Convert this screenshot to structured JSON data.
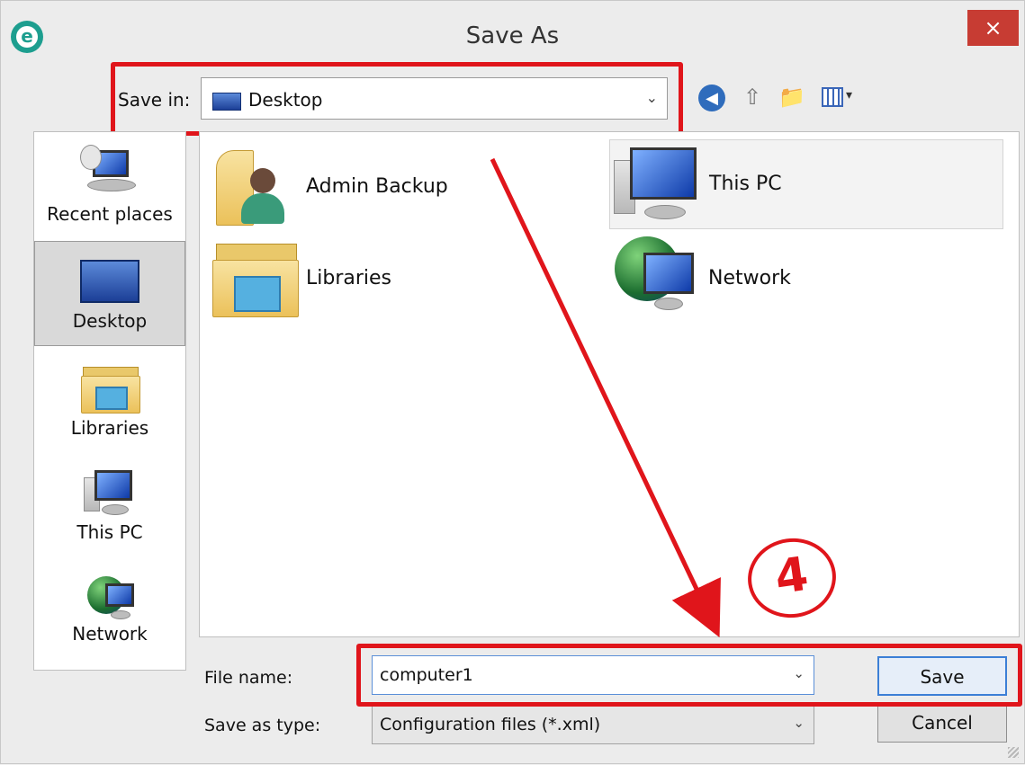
{
  "window": {
    "title": "Save As",
    "close_label": "×",
    "app_icon_letter": "e"
  },
  "toolbar": {
    "save_in_label": "Save in:",
    "save_in_value": "Desktop",
    "dropdown_symbol": "⌄",
    "icons": [
      "back-icon",
      "up-folder-icon",
      "new-folder-icon",
      "view-menu-icon"
    ]
  },
  "places": [
    {
      "label": "Recent places",
      "icon": "recent-places-icon"
    },
    {
      "label": "Desktop",
      "icon": "desktop-icon",
      "selected": true
    },
    {
      "label": "Libraries",
      "icon": "libraries-icon"
    },
    {
      "label": "This PC",
      "icon": "this-pc-icon"
    },
    {
      "label": "Network",
      "icon": "network-icon"
    }
  ],
  "files": [
    {
      "label": "Admin Backup",
      "icon": "user-folder-icon"
    },
    {
      "label": "This PC",
      "icon": "this-pc-icon",
      "selected": true
    },
    {
      "label": "Libraries",
      "icon": "libraries-icon"
    },
    {
      "label": "Network",
      "icon": "network-icon"
    }
  ],
  "form": {
    "file_name_label": "File name:",
    "file_name_value": "computer1",
    "save_as_type_label": "Save as type:",
    "save_as_type_value": "Configuration files (*.xml)",
    "save_button": "Save",
    "cancel_button": "Cancel"
  },
  "annotation": {
    "step_number": "4"
  },
  "colors": {
    "annotation_red": "#e0151b",
    "close_red": "#c73c33",
    "eset_teal": "#1d9e8f"
  }
}
